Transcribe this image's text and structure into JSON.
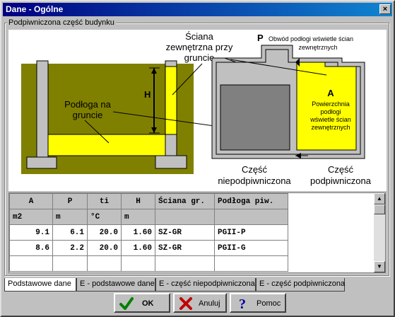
{
  "window": {
    "title": "Dane - Ogólne",
    "close_label": "×"
  },
  "group": {
    "label": "Podpiwniczona część budynku"
  },
  "diagram": {
    "label_sciana": [
      "Ściana",
      "zewnętrzna przy",
      "gruncie"
    ],
    "label_podloga": [
      "Podłoga na",
      "gruncie"
    ],
    "label_H": "H",
    "label_P": "P",
    "label_P_desc": "Obwód podłogi wświetle ścian",
    "label_P_desc2": "zewnętrznych",
    "label_A": "A",
    "label_A_desc": [
      "Powierzchnia",
      "podłogi",
      "wświetle ścian",
      "zewnętrznych"
    ],
    "label_niepodp": [
      "Część",
      "niepodpiwniczona"
    ],
    "label_podp": [
      "Część",
      "podpiwniczona"
    ],
    "colors": {
      "soil": "#808000",
      "yellow": "#ffff00",
      "gray": "#808080",
      "lightgray": "#c0c0c0"
    }
  },
  "table": {
    "headers": [
      "A",
      "P",
      "ti",
      "H",
      "Ściana gr.",
      "Podłoga piw."
    ],
    "units": [
      "m2",
      "m",
      "°C",
      "m",
      "",
      ""
    ],
    "rows": [
      [
        "9.1",
        "6.1",
        "20.0",
        "1.60",
        "SZ-GR",
        "PGII-P"
      ],
      [
        "8.6",
        "2.2",
        "20.0",
        "1.60",
        "SZ-GR",
        "PGII-G"
      ]
    ]
  },
  "tabs": [
    "Podstawowe dane",
    "E - podstawowe dane",
    "E - część niepodpiwniczona",
    "E - część podpiwniczona"
  ],
  "buttons": {
    "ok": "OK",
    "cancel": "Anuluj",
    "help": "Pomoc"
  },
  "scrollbar": {
    "up": "▲",
    "down": "▼"
  }
}
